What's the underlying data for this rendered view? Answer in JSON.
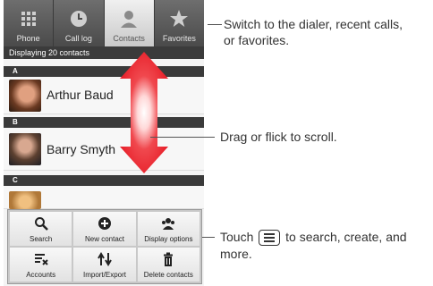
{
  "tabs": [
    {
      "label": "Phone",
      "icon": "dialpad-icon"
    },
    {
      "label": "Call log",
      "icon": "clock-icon"
    },
    {
      "label": "Contacts",
      "icon": "person-icon",
      "active": true
    },
    {
      "label": "Favorites",
      "icon": "star-icon"
    }
  ],
  "status": "Displaying 20 contacts",
  "sections": [
    {
      "letter": "A",
      "contact": "Arthur Baud"
    },
    {
      "letter": "B",
      "contact": "Barry Smyth"
    },
    {
      "letter": "C",
      "contact": ""
    }
  ],
  "menu": [
    {
      "label": "Search",
      "icon": "magnifier-icon"
    },
    {
      "label": "New contact",
      "icon": "plus-icon"
    },
    {
      "label": "Display options",
      "icon": "people-icon"
    },
    {
      "label": "Accounts",
      "icon": "accounts-icon"
    },
    {
      "label": "Import/Export",
      "icon": "arrows-icon"
    },
    {
      "label": "Delete contacts",
      "icon": "trash-icon"
    }
  ],
  "callouts": {
    "tabs": [
      "Switch to the dialer, recent calls,",
      "or favorites."
    ],
    "scroll": "Drag or flick to scroll.",
    "menu_before": "Touch",
    "menu_after": "to search, create, and",
    "menu_line2": "more."
  },
  "colors": {
    "scroll_red": "#e8202a",
    "tab_dark": "#555555"
  }
}
